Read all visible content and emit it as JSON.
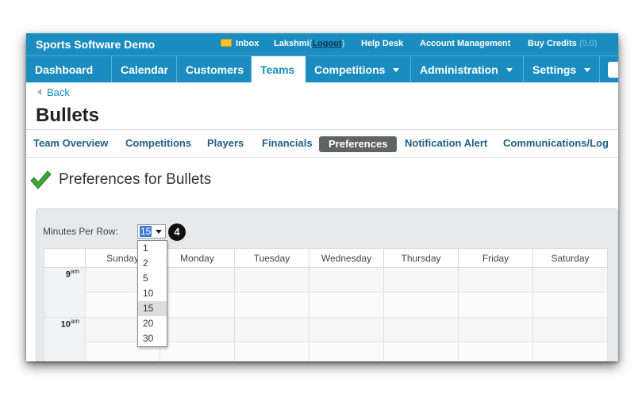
{
  "app": {
    "title": "Sports Software Demo"
  },
  "utility": {
    "inbox": "Inbox",
    "user": "Lakshmi",
    "paren_open": "(",
    "logout": "Logout",
    "paren_close": ")",
    "help": "Help Desk",
    "account": "Account Management",
    "buy_credits": "Buy Credits",
    "credits": "(0.0)"
  },
  "nav": {
    "items": [
      {
        "label": "Dashboard"
      },
      {
        "label": "Calendar"
      },
      {
        "label": "Customers"
      },
      {
        "label": "Teams",
        "active": true
      },
      {
        "label": "Competitions",
        "dropdown": true
      },
      {
        "label": "Administration",
        "dropdown": true
      },
      {
        "label": "Settings",
        "dropdown": true
      }
    ]
  },
  "back_label": "Back",
  "page_title": "Bullets",
  "subnav": {
    "items": [
      {
        "label": "Team Overview"
      },
      {
        "label": "Competitions"
      },
      {
        "label": "Players"
      },
      {
        "label": "Financials"
      },
      {
        "label": "Preferences",
        "active": true
      },
      {
        "label": "Notification Alert"
      },
      {
        "label": "Communications/Log"
      }
    ]
  },
  "preferences_heading": "Preferences for Bullets",
  "minutes_per_row": {
    "label": "Minutes Per Row:",
    "value": "15",
    "options": [
      "1",
      "2",
      "5",
      "10",
      "15",
      "20",
      "30"
    ],
    "selected_index": 4
  },
  "step_badge": "4",
  "calendar": {
    "days": [
      "Sunday",
      "Monday",
      "Tuesday",
      "Wednesday",
      "Thursday",
      "Friday",
      "Saturday"
    ],
    "times": [
      {
        "hour": "9",
        "suffix": "am"
      },
      {
        "hour": "10",
        "suffix": "am"
      }
    ]
  },
  "colors": {
    "brand_blue": "#1a8cc0",
    "active_tab_bg": "#5f6466",
    "check_green": "#3aa635"
  },
  "icons": {
    "inbox": "mail-icon",
    "back": "back-arrow-icon",
    "heading": "checkmark-icon",
    "select": "chevron-down-icon"
  }
}
